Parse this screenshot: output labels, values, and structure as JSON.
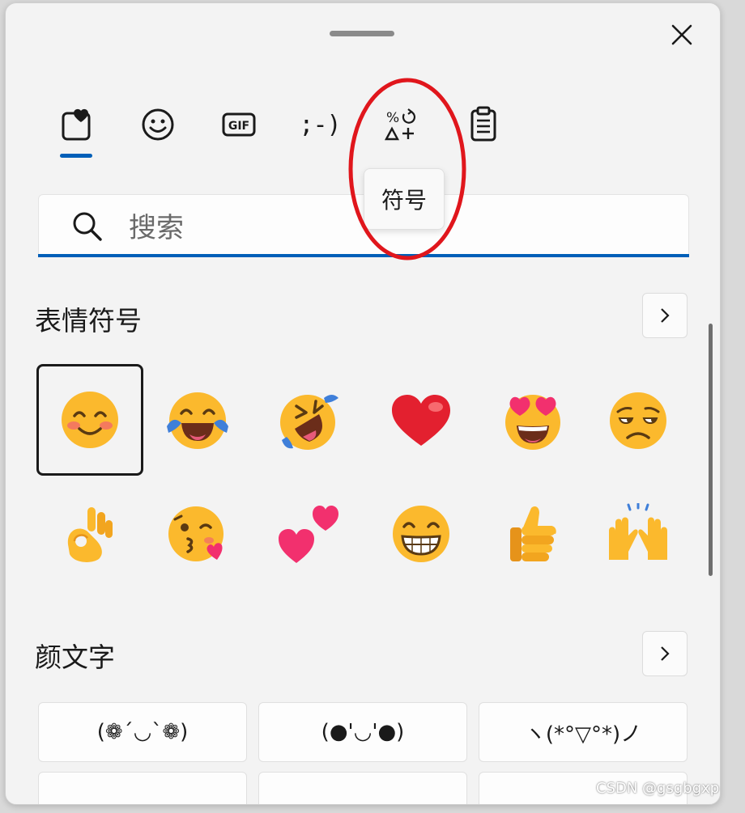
{
  "tabs": [
    {
      "name": "tab-favorites",
      "icon": "heart-clipboard-icon"
    },
    {
      "name": "tab-emoji",
      "icon": "smiley-icon"
    },
    {
      "name": "tab-gif",
      "icon": "gif-icon",
      "label": "GIF"
    },
    {
      "name": "tab-kaomoji",
      "icon": "kaomoji-icon",
      "label": ";-)"
    },
    {
      "name": "tab-symbols",
      "icon": "symbols-icon"
    },
    {
      "name": "tab-clipboard",
      "icon": "clipboard-icon"
    }
  ],
  "tooltip": {
    "text": "符号"
  },
  "search": {
    "placeholder": "搜索",
    "value": ""
  },
  "emoji_section": {
    "title": "表情符号",
    "items": [
      "smiling-face-with-smiling-eyes",
      "face-with-tears-of-joy",
      "rolling-on-the-floor-laughing",
      "red-heart",
      "smiling-face-with-heart-eyes",
      "unamused-face",
      "ok-hand",
      "face-blowing-a-kiss",
      "two-hearts",
      "beaming-face-with-smiling-eyes",
      "thumbs-up",
      "raising-hands"
    ]
  },
  "kaomoji_section": {
    "title": "颜文字",
    "items": [
      "(❁´◡`❁)",
      "(●'◡'●)",
      "ヽ(*°▽°*)ノ",
      "",
      "",
      ""
    ]
  },
  "colors": {
    "accent": "#005fb8",
    "annotation": "#e0161c",
    "emoji_yellow": "#fbb92d"
  },
  "watermark": {
    "text": "CSDN @gsgbgxp"
  }
}
